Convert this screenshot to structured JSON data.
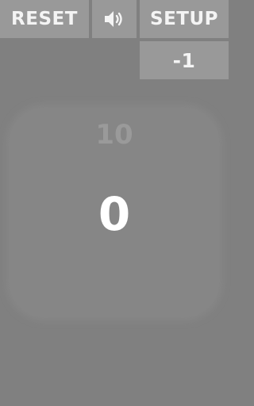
{
  "toolbar": {
    "reset_label": "RESET",
    "setup_label": "SETUP",
    "sound_icon": "speaker-volume-icon"
  },
  "step_button": {
    "label": "-1"
  },
  "counter": {
    "target": "10",
    "value": "0"
  },
  "colors": {
    "background": "#808080",
    "button": "#999999",
    "card": "#868686",
    "target_text": "#9a9a9a",
    "value_text": "#ffffff"
  }
}
